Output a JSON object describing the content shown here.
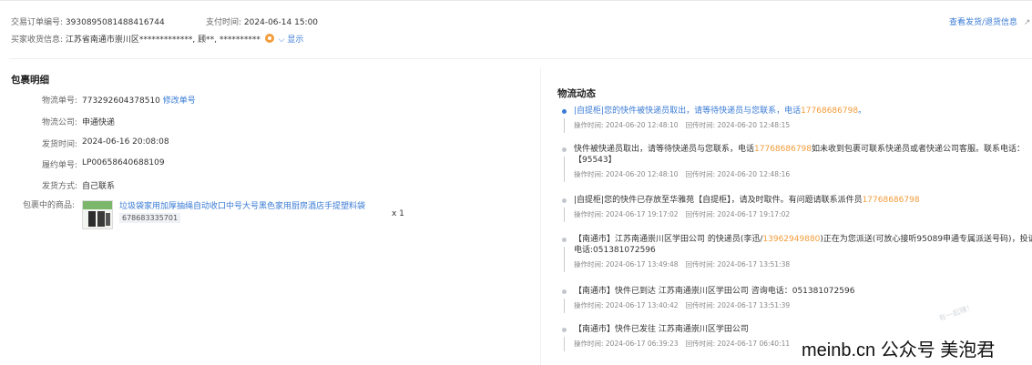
{
  "order": {
    "order_no_label": "交易订单编号:",
    "order_no": "3930895081488416744",
    "pay_time_label": "支付时间:",
    "pay_time": "2024-06-14 15:00",
    "buyer_label": "买家收货信息:",
    "buyer_info": "江苏省南通市崇川区*************, 顾**, **********",
    "show_label": "显示",
    "view_shipping_link": "查看发货/退货信息"
  },
  "package": {
    "title": "包裹明细",
    "tracking_label": "物流单号:",
    "tracking_no": "773292604378510",
    "edit_tracking": "修改单号",
    "carrier_label": "物流公司:",
    "carrier": "申通快递",
    "ship_time_label": "发货时间:",
    "ship_time": "2024-06-16 20:08:08",
    "fulfill_label": "履约单号:",
    "fulfill_no": "LP00658640688109",
    "ship_method_label": "发货方式:",
    "ship_method": "自己联系",
    "goods_label": "包裹中的商品:",
    "product_name": "垃圾袋家用加厚抽绳自动收口中号大号黑色家用厨房酒店手提塑料袋",
    "product_id": "678683335701",
    "quantity": "x 1"
  },
  "logistics": {
    "title": "物流动态",
    "events": [
      {
        "text_a": "|自提柜|您的快件被快递员取出，请等待快递员与您联系，电话",
        "phone": "17768686798",
        "text_b": "。",
        "op_time": "操作时间: 2024-06-20 12:48:10",
        "cb_time": "回传时间: 2024-06-20 12:48:15"
      },
      {
        "text_a": "快件被快递员取出，请等待快递员与您联系，电话",
        "phone": "17768686798",
        "text_b": "如未收到包裹可联系快递员或者快递公司客服。联系电话：【95543】",
        "op_time": "操作时间: 2024-06-20 12:48:10",
        "cb_time": "回传时间: 2024-06-20 12:48:16"
      },
      {
        "text_a": "|自提柜|您的快件已存放至华雅苑【自提柜】，请及时取件。有问题请联系派件员",
        "phone": "17768686798",
        "text_b": "",
        "op_time": "操作时间: 2024-06-17 19:17:02",
        "cb_time": "回传时间: 2024-06-17 19:17:02"
      },
      {
        "text_a": "【南通市】江苏南通崇川区学田公司 的快递员(李迅/",
        "phone": "13962949880",
        "text_b": ")正在为您派送(可放心接听95089申通专属派送号码)，投诉电话:051381072596",
        "op_time": "操作时间: 2024-06-17 13:49:48",
        "cb_time": "回传时间: 2024-06-17 13:51:38"
      },
      {
        "text_a": "【南通市】快件已到达 江苏南通崇川区学田公司 咨询电话：051381072596",
        "phone": "",
        "text_b": "",
        "op_time": "操作时间: 2024-06-17 13:40:42",
        "cb_time": "回传时间: 2024-06-17 13:51:39"
      },
      {
        "text_a": "【南通市】快件已发往 江苏南通崇川区学田公司",
        "phone": "",
        "text_b": "",
        "op_time": "操作时间: 2024-06-17 06:39:23",
        "cb_time": "回传时间: 2024-06-17 06:40:11"
      }
    ]
  },
  "watermark": "meinb.cn 公众号 美泡君",
  "faint_watermark": "有一起赚！",
  "colors": {
    "link": "#3a7bd5",
    "phone": "#f39c3b",
    "accent_dot": "#3a7bd5"
  },
  "icons": {
    "privacy": "eye-privacy-icon",
    "external": "external-link-icon"
  }
}
